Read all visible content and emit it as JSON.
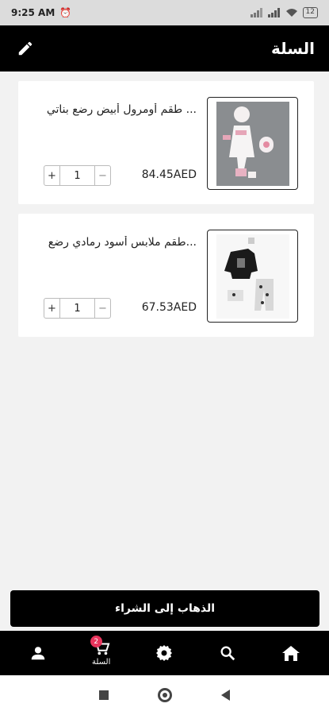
{
  "status": {
    "time": "9:25 AM",
    "battery": "12"
  },
  "header": {
    "title": "السلة"
  },
  "cart": {
    "items": [
      {
        "name": "طقم أومرول أبيض رضع بناتي ...",
        "price": "84.45AED",
        "qty": "1",
        "plus": "+",
        "minus": "−"
      },
      {
        "name": "طقم ملابس أسود رمادي رضع...",
        "price": "67.53AED",
        "qty": "1",
        "plus": "+",
        "minus": "−"
      }
    ]
  },
  "checkout": {
    "label": "الذهاب إلى الشراء"
  },
  "bottom_nav": {
    "cart_label": "السلة",
    "cart_badge": "2"
  },
  "icons": {
    "edit": "pencil-icon",
    "profile": "person-icon",
    "cart": "cart-icon",
    "settings": "gear-icon",
    "search": "search-icon",
    "home": "home-icon"
  },
  "colors": {
    "header": "#000000",
    "badge": "#e8345c",
    "background": "#f2f2f2"
  }
}
